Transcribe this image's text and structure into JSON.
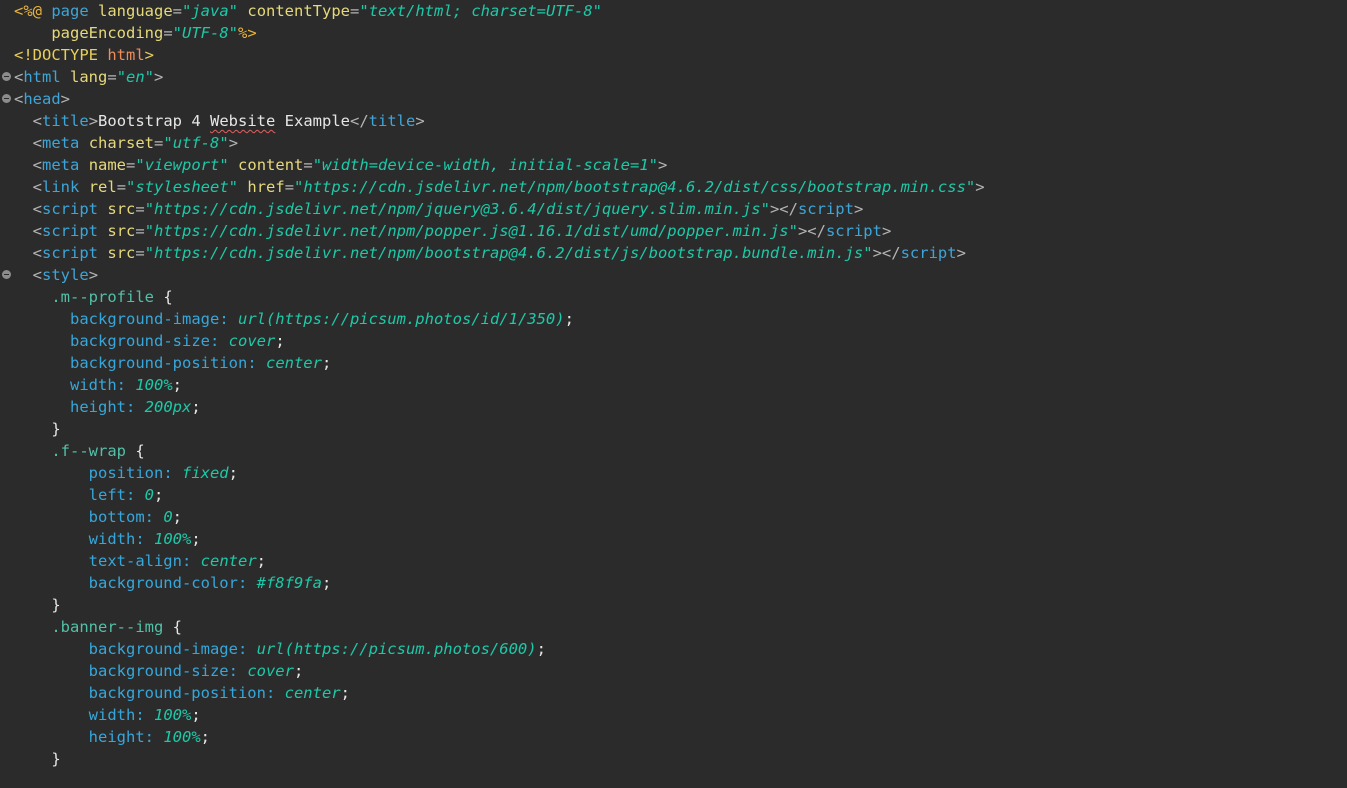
{
  "colors": {
    "background": "#2b2b2b",
    "tag": "#3ea5d8",
    "bracket": "#b4b4b4",
    "attribute": "#e6d97a",
    "string": "#1cc9a8",
    "text": "#e6e6e6",
    "selector": "#52c0a8",
    "property": "#36a7db",
    "css_value": "#1cc9a8",
    "jsp_delim": "#e8b33c",
    "doctype": "#e9cf5a",
    "doctype_html": "#ef8c5a"
  },
  "lines": [
    {
      "fold": false,
      "indent": "",
      "tokens": [
        {
          "t": "<%@",
          "c": "jsp_delim"
        },
        {
          "t": " ",
          "c": "text"
        },
        {
          "t": "page",
          "c": "tag"
        },
        {
          "t": " ",
          "c": "text"
        },
        {
          "t": "language",
          "c": "attribute"
        },
        {
          "t": "=",
          "c": "bracket"
        },
        {
          "t": "\"java\"",
          "c": "string",
          "i": true
        },
        {
          "t": " ",
          "c": "text"
        },
        {
          "t": "contentType",
          "c": "attribute"
        },
        {
          "t": "=",
          "c": "bracket"
        },
        {
          "t": "\"text/html; charset=UTF-8\"",
          "c": "string",
          "i": true
        }
      ]
    },
    {
      "fold": false,
      "indent": "    ",
      "tokens": [
        {
          "t": "pageEncoding",
          "c": "attribute"
        },
        {
          "t": "=",
          "c": "bracket"
        },
        {
          "t": "\"UTF-8\"",
          "c": "string",
          "i": true
        },
        {
          "t": "%>",
          "c": "jsp_delim"
        }
      ]
    },
    {
      "fold": false,
      "indent": "",
      "tokens": [
        {
          "t": "<!DOCTYPE ",
          "c": "doctype"
        },
        {
          "t": "html",
          "c": "doctype_html"
        },
        {
          "t": ">",
          "c": "doctype"
        }
      ]
    },
    {
      "fold": true,
      "indent": "",
      "tokens": [
        {
          "t": "<",
          "c": "bracket"
        },
        {
          "t": "html",
          "c": "tag"
        },
        {
          "t": " ",
          "c": "text"
        },
        {
          "t": "lang",
          "c": "attribute"
        },
        {
          "t": "=",
          "c": "bracket"
        },
        {
          "t": "\"en\"",
          "c": "string",
          "i": true
        },
        {
          "t": ">",
          "c": "bracket"
        }
      ]
    },
    {
      "fold": true,
      "indent": "",
      "tokens": [
        {
          "t": "<",
          "c": "bracket"
        },
        {
          "t": "head",
          "c": "tag"
        },
        {
          "t": ">",
          "c": "bracket"
        }
      ]
    },
    {
      "fold": false,
      "indent": "  ",
      "tokens": [
        {
          "t": "<",
          "c": "bracket"
        },
        {
          "t": "title",
          "c": "tag"
        },
        {
          "t": ">",
          "c": "bracket"
        },
        {
          "t": "Bootstrap 4 ",
          "c": "text"
        },
        {
          "t": "Website",
          "c": "text",
          "spell": true
        },
        {
          "t": " Example",
          "c": "text"
        },
        {
          "t": "</",
          "c": "bracket"
        },
        {
          "t": "title",
          "c": "tag"
        },
        {
          "t": ">",
          "c": "bracket"
        }
      ]
    },
    {
      "fold": false,
      "indent": "  ",
      "tokens": [
        {
          "t": "<",
          "c": "bracket"
        },
        {
          "t": "meta",
          "c": "tag"
        },
        {
          "t": " ",
          "c": "text"
        },
        {
          "t": "charset",
          "c": "attribute"
        },
        {
          "t": "=",
          "c": "bracket"
        },
        {
          "t": "\"utf-8\"",
          "c": "string",
          "i": true
        },
        {
          "t": ">",
          "c": "bracket"
        }
      ]
    },
    {
      "fold": false,
      "indent": "  ",
      "tokens": [
        {
          "t": "<",
          "c": "bracket"
        },
        {
          "t": "meta",
          "c": "tag"
        },
        {
          "t": " ",
          "c": "text"
        },
        {
          "t": "name",
          "c": "attribute"
        },
        {
          "t": "=",
          "c": "bracket"
        },
        {
          "t": "\"viewport\"",
          "c": "string",
          "i": true
        },
        {
          "t": " ",
          "c": "text"
        },
        {
          "t": "content",
          "c": "attribute"
        },
        {
          "t": "=",
          "c": "bracket"
        },
        {
          "t": "\"width=device-width, initial-scale=1\"",
          "c": "string",
          "i": true
        },
        {
          "t": ">",
          "c": "bracket"
        }
      ]
    },
    {
      "fold": false,
      "indent": "  ",
      "tokens": [
        {
          "t": "<",
          "c": "bracket"
        },
        {
          "t": "link",
          "c": "tag"
        },
        {
          "t": " ",
          "c": "text"
        },
        {
          "t": "rel",
          "c": "attribute"
        },
        {
          "t": "=",
          "c": "bracket"
        },
        {
          "t": "\"stylesheet\"",
          "c": "string",
          "i": true
        },
        {
          "t": " ",
          "c": "text"
        },
        {
          "t": "href",
          "c": "attribute"
        },
        {
          "t": "=",
          "c": "bracket"
        },
        {
          "t": "\"https://cdn.jsdelivr.net/npm/bootstrap@4.6.2/dist/css/bootstrap.min.css\"",
          "c": "string",
          "i": true
        },
        {
          "t": ">",
          "c": "bracket"
        }
      ]
    },
    {
      "fold": false,
      "indent": "  ",
      "tokens": [
        {
          "t": "<",
          "c": "bracket"
        },
        {
          "t": "script",
          "c": "tag"
        },
        {
          "t": " ",
          "c": "text"
        },
        {
          "t": "src",
          "c": "attribute"
        },
        {
          "t": "=",
          "c": "bracket"
        },
        {
          "t": "\"https://cdn.jsdelivr.net/npm/jquery@3.6.4/dist/jquery.slim.min.js\"",
          "c": "string",
          "i": true
        },
        {
          "t": "></",
          "c": "bracket"
        },
        {
          "t": "script",
          "c": "tag"
        },
        {
          "t": ">",
          "c": "bracket"
        }
      ]
    },
    {
      "fold": false,
      "indent": "  ",
      "tokens": [
        {
          "t": "<",
          "c": "bracket"
        },
        {
          "t": "script",
          "c": "tag"
        },
        {
          "t": " ",
          "c": "text"
        },
        {
          "t": "src",
          "c": "attribute"
        },
        {
          "t": "=",
          "c": "bracket"
        },
        {
          "t": "\"https://cdn.jsdelivr.net/npm/popper.js@1.16.1/dist/umd/popper.min.js\"",
          "c": "string",
          "i": true
        },
        {
          "t": "></",
          "c": "bracket"
        },
        {
          "t": "script",
          "c": "tag"
        },
        {
          "t": ">",
          "c": "bracket"
        }
      ]
    },
    {
      "fold": false,
      "indent": "  ",
      "tokens": [
        {
          "t": "<",
          "c": "bracket"
        },
        {
          "t": "script",
          "c": "tag"
        },
        {
          "t": " ",
          "c": "text"
        },
        {
          "t": "src",
          "c": "attribute"
        },
        {
          "t": "=",
          "c": "bracket"
        },
        {
          "t": "\"https://cdn.jsdelivr.net/npm/bootstrap@4.6.2/dist/js/bootstrap.bundle.min.js\"",
          "c": "string",
          "i": true
        },
        {
          "t": "></",
          "c": "bracket"
        },
        {
          "t": "script",
          "c": "tag"
        },
        {
          "t": ">",
          "c": "bracket"
        }
      ]
    },
    {
      "fold": true,
      "indent": "  ",
      "tokens": [
        {
          "t": "<",
          "c": "bracket"
        },
        {
          "t": "style",
          "c": "tag"
        },
        {
          "t": ">",
          "c": "bracket"
        }
      ]
    },
    {
      "fold": false,
      "indent": "    ",
      "tokens": [
        {
          "t": ".m--profile",
          "c": "selector"
        },
        {
          "t": " {",
          "c": "text"
        }
      ]
    },
    {
      "fold": false,
      "indent": "      ",
      "tokens": [
        {
          "t": "background-image",
          "c": "property"
        },
        {
          "t": ": ",
          "c": "property"
        },
        {
          "t": "url(https://picsum.photos/id/1/350)",
          "c": "css_value",
          "i": true
        },
        {
          "t": ";",
          "c": "text"
        }
      ]
    },
    {
      "fold": false,
      "indent": "      ",
      "tokens": [
        {
          "t": "background-size",
          "c": "property"
        },
        {
          "t": ": ",
          "c": "property"
        },
        {
          "t": "cover",
          "c": "css_value",
          "i": true
        },
        {
          "t": ";",
          "c": "text"
        }
      ]
    },
    {
      "fold": false,
      "indent": "      ",
      "tokens": [
        {
          "t": "background-position",
          "c": "property"
        },
        {
          "t": ": ",
          "c": "property"
        },
        {
          "t": "center",
          "c": "css_value",
          "i": true
        },
        {
          "t": ";",
          "c": "text"
        }
      ]
    },
    {
      "fold": false,
      "indent": "      ",
      "tokens": [
        {
          "t": "width",
          "c": "property"
        },
        {
          "t": ": ",
          "c": "property"
        },
        {
          "t": "100%",
          "c": "css_value",
          "i": true
        },
        {
          "t": ";",
          "c": "text"
        }
      ]
    },
    {
      "fold": false,
      "indent": "      ",
      "tokens": [
        {
          "t": "height",
          "c": "property"
        },
        {
          "t": ": ",
          "c": "property"
        },
        {
          "t": "200px",
          "c": "css_value",
          "i": true
        },
        {
          "t": ";",
          "c": "text"
        }
      ]
    },
    {
      "fold": false,
      "indent": "    ",
      "tokens": [
        {
          "t": "}",
          "c": "text"
        }
      ]
    },
    {
      "fold": false,
      "indent": "    ",
      "tokens": [
        {
          "t": ".f--wrap",
          "c": "selector"
        },
        {
          "t": " {",
          "c": "text"
        }
      ]
    },
    {
      "fold": false,
      "indent": "        ",
      "tokens": [
        {
          "t": "position",
          "c": "property"
        },
        {
          "t": ": ",
          "c": "property"
        },
        {
          "t": "fixed",
          "c": "css_value",
          "i": true
        },
        {
          "t": ";",
          "c": "text"
        }
      ]
    },
    {
      "fold": false,
      "indent": "        ",
      "tokens": [
        {
          "t": "left",
          "c": "property"
        },
        {
          "t": ": ",
          "c": "property"
        },
        {
          "t": "0",
          "c": "css_value",
          "i": true
        },
        {
          "t": ";",
          "c": "text"
        }
      ]
    },
    {
      "fold": false,
      "indent": "        ",
      "tokens": [
        {
          "t": "bottom",
          "c": "property"
        },
        {
          "t": ": ",
          "c": "property"
        },
        {
          "t": "0",
          "c": "css_value",
          "i": true
        },
        {
          "t": ";",
          "c": "text"
        }
      ]
    },
    {
      "fold": false,
      "indent": "        ",
      "tokens": [
        {
          "t": "width",
          "c": "property"
        },
        {
          "t": ": ",
          "c": "property"
        },
        {
          "t": "100%",
          "c": "css_value",
          "i": true
        },
        {
          "t": ";",
          "c": "text"
        }
      ]
    },
    {
      "fold": false,
      "indent": "        ",
      "tokens": [
        {
          "t": "text-align",
          "c": "property"
        },
        {
          "t": ": ",
          "c": "property"
        },
        {
          "t": "center",
          "c": "css_value",
          "i": true
        },
        {
          "t": ";",
          "c": "text"
        }
      ]
    },
    {
      "fold": false,
      "indent": "        ",
      "tokens": [
        {
          "t": "background-color",
          "c": "property"
        },
        {
          "t": ": ",
          "c": "property"
        },
        {
          "t": "#f8f9fa",
          "c": "css_value",
          "i": true
        },
        {
          "t": ";",
          "c": "text"
        }
      ]
    },
    {
      "fold": false,
      "indent": "    ",
      "tokens": [
        {
          "t": "}",
          "c": "text"
        }
      ]
    },
    {
      "fold": false,
      "indent": "    ",
      "tokens": [
        {
          "t": ".banner--img",
          "c": "selector"
        },
        {
          "t": " {",
          "c": "text"
        }
      ]
    },
    {
      "fold": false,
      "indent": "        ",
      "tokens": [
        {
          "t": "background-image",
          "c": "property"
        },
        {
          "t": ": ",
          "c": "property"
        },
        {
          "t": "url(https://picsum.photos/600)",
          "c": "css_value",
          "i": true
        },
        {
          "t": ";",
          "c": "text"
        }
      ]
    },
    {
      "fold": false,
      "indent": "        ",
      "tokens": [
        {
          "t": "background-size",
          "c": "property"
        },
        {
          "t": ": ",
          "c": "property"
        },
        {
          "t": "cover",
          "c": "css_value",
          "i": true
        },
        {
          "t": ";",
          "c": "text"
        }
      ]
    },
    {
      "fold": false,
      "indent": "        ",
      "tokens": [
        {
          "t": "background-position",
          "c": "property"
        },
        {
          "t": ": ",
          "c": "property"
        },
        {
          "t": "center",
          "c": "css_value",
          "i": true
        },
        {
          "t": ";",
          "c": "text"
        }
      ]
    },
    {
      "fold": false,
      "indent": "        ",
      "tokens": [
        {
          "t": "width",
          "c": "property"
        },
        {
          "t": ": ",
          "c": "property"
        },
        {
          "t": "100%",
          "c": "css_value",
          "i": true
        },
        {
          "t": ";",
          "c": "text"
        }
      ]
    },
    {
      "fold": false,
      "indent": "        ",
      "tokens": [
        {
          "t": "height",
          "c": "property"
        },
        {
          "t": ": ",
          "c": "property"
        },
        {
          "t": "100%",
          "c": "css_value",
          "i": true
        },
        {
          "t": ";",
          "c": "text"
        }
      ]
    },
    {
      "fold": false,
      "indent": "    ",
      "tokens": [
        {
          "t": "}",
          "c": "text"
        }
      ]
    }
  ]
}
